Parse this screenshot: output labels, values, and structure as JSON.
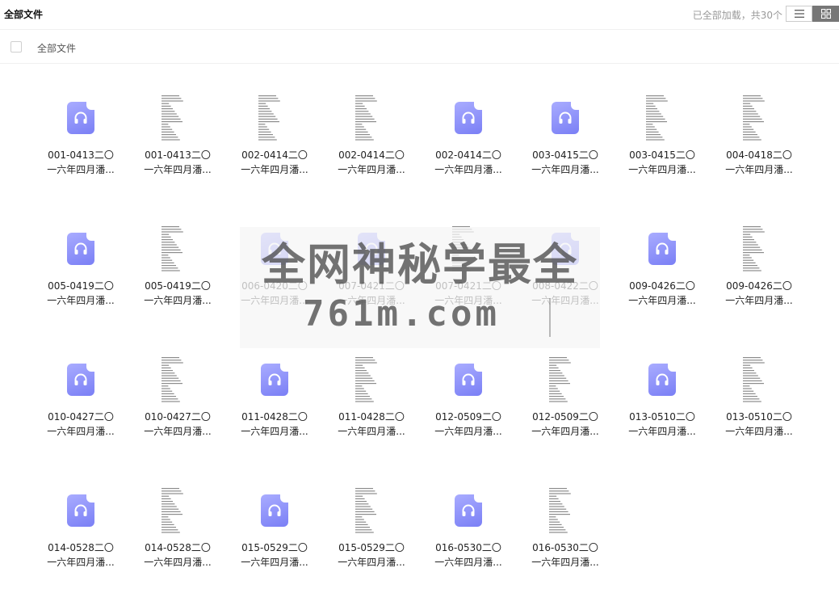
{
  "header": {
    "title": "全部文件",
    "loaded_status": "已全部加载，共30个",
    "view_list_icon": "list-view-icon",
    "view_grid_icon": "grid-view-icon"
  },
  "toolbar": {
    "select_all_checked": false,
    "breadcrumb": "全部文件"
  },
  "colors": {
    "audio_icon": "#8a8ef8",
    "active_view": "#777777"
  },
  "files": [
    {
      "line1": "001-0413二〇",
      "line2": "一六年四月潘...",
      "kind": "audio"
    },
    {
      "line1": "001-0413二〇",
      "line2": "一六年四月潘...",
      "kind": "doc"
    },
    {
      "line1": "002-0414二〇",
      "line2": "一六年四月潘...",
      "kind": "doc"
    },
    {
      "line1": "002-0414二〇",
      "line2": "一六年四月潘...",
      "kind": "doc"
    },
    {
      "line1": "002-0414二〇",
      "line2": "一六年四月潘...",
      "kind": "audio"
    },
    {
      "line1": "003-0415二〇",
      "line2": "一六年四月潘...",
      "kind": "audio"
    },
    {
      "line1": "003-0415二〇",
      "line2": "一六年四月潘...",
      "kind": "doc"
    },
    {
      "line1": "004-0418二〇",
      "line2": "一六年四月潘...",
      "kind": "doc"
    },
    {
      "line1": "005-0419二〇",
      "line2": "一六年四月潘...",
      "kind": "audio"
    },
    {
      "line1": "005-0419二〇",
      "line2": "一六年四月潘...",
      "kind": "doc"
    },
    {
      "line1": "006-0420二〇",
      "line2": "一六年四月潘...",
      "kind": "audio"
    },
    {
      "line1": "007-0421二〇",
      "line2": "一六年四月潘...",
      "kind": "audio"
    },
    {
      "line1": "007-0421二〇",
      "line2": "一六年四月潘...",
      "kind": "doc"
    },
    {
      "line1": "008-0422二〇",
      "line2": "一六年四月潘...",
      "kind": "audio"
    },
    {
      "line1": "009-0426二〇",
      "line2": "一六年四月潘...",
      "kind": "audio"
    },
    {
      "line1": "009-0426二〇",
      "line2": "一六年四月潘...",
      "kind": "doc"
    },
    {
      "line1": "010-0427二〇",
      "line2": "一六年四月潘...",
      "kind": "audio"
    },
    {
      "line1": "010-0427二〇",
      "line2": "一六年四月潘...",
      "kind": "doc"
    },
    {
      "line1": "011-0428二〇",
      "line2": "一六年四月潘...",
      "kind": "audio"
    },
    {
      "line1": "011-0428二〇",
      "line2": "一六年四月潘...",
      "kind": "doc"
    },
    {
      "line1": "012-0509二〇",
      "line2": "一六年四月潘...",
      "kind": "audio"
    },
    {
      "line1": "012-0509二〇",
      "line2": "一六年四月潘...",
      "kind": "doc"
    },
    {
      "line1": "013-0510二〇",
      "line2": "一六年四月潘...",
      "kind": "audio"
    },
    {
      "line1": "013-0510二〇",
      "line2": "一六年四月潘...",
      "kind": "doc"
    },
    {
      "line1": "014-0528二〇",
      "line2": "一六年四月潘...",
      "kind": "audio"
    },
    {
      "line1": "014-0528二〇",
      "line2": "一六年四月潘...",
      "kind": "doc"
    },
    {
      "line1": "015-0529二〇",
      "line2": "一六年四月潘...",
      "kind": "audio"
    },
    {
      "line1": "015-0529二〇",
      "line2": "一六年四月潘...",
      "kind": "doc"
    },
    {
      "line1": "016-0530二〇",
      "line2": "一六年四月潘...",
      "kind": "audio"
    },
    {
      "line1": "016-0530二〇",
      "line2": "一六年四月潘...",
      "kind": "doc"
    }
  ],
  "watermark": {
    "line1": "全网神秘学最全",
    "line2": "761m.com"
  }
}
